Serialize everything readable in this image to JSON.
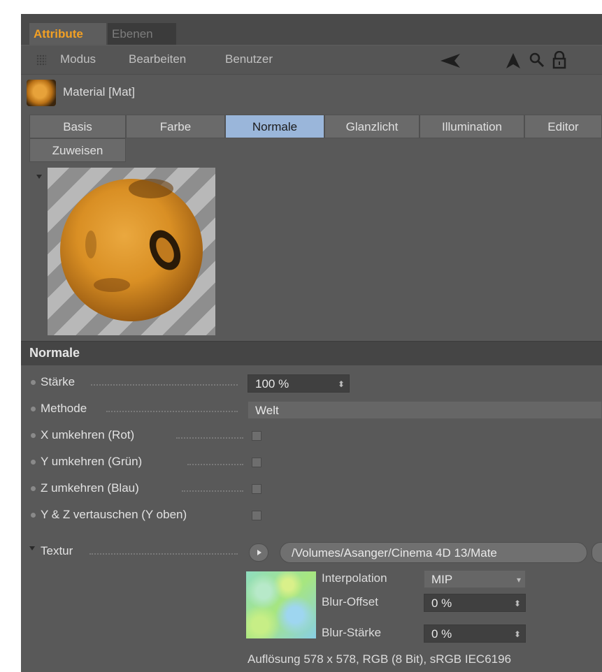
{
  "header": {
    "tabs": [
      {
        "label": "Attribute",
        "active": true
      },
      {
        "label": "Ebenen",
        "active": false
      }
    ],
    "menu": [
      "Modus",
      "Bearbeiten",
      "Benutzer"
    ],
    "icons": [
      "back-arrow-icon",
      "cursor-arrow-icon",
      "search-icon",
      "lock-icon"
    ]
  },
  "material": {
    "title": "Material [Mat]"
  },
  "material_tabs": [
    {
      "label": "Basis",
      "active": false
    },
    {
      "label": "Farbe",
      "active": false
    },
    {
      "label": "Normale",
      "active": true
    },
    {
      "label": "Glanzlicht",
      "active": false
    },
    {
      "label": "Illumination",
      "active": false
    },
    {
      "label": "Editor",
      "active": false
    },
    {
      "label": "Zuweisen",
      "active": false
    }
  ],
  "section": {
    "title": "Normale"
  },
  "params": {
    "staerke": {
      "label": "Stärke",
      "value": "100 %"
    },
    "methode": {
      "label": "Methode",
      "value": "Welt"
    },
    "x_umkehren": {
      "label": "X umkehren (Rot)",
      "checked": false
    },
    "y_umkehren": {
      "label": "Y umkehren (Grün)",
      "checked": false
    },
    "z_umkehren": {
      "label": "Z umkehren (Blau)",
      "checked": false
    },
    "yz_tauschen": {
      "label": "Y & Z vertauschen (Y oben)",
      "checked": false
    }
  },
  "textur": {
    "label": "Textur",
    "path": "/Volumes/Asanger/Cinema 4D 13/Mate",
    "interpolation_label": "Interpolation",
    "interpolation_value": "MIP",
    "blur_offset_label": "Blur-Offset",
    "blur_offset_value": "0 %",
    "blur_staerke_label": "Blur-Stärke",
    "blur_staerke_value": "0 %",
    "info": "Auflösung 578 x 578, RGB (8 Bit), sRGB IEC6196"
  },
  "colors": {
    "panel_bg": "#595959",
    "active_tab_text": "#f2a024",
    "active_material_tab": "#9ab6da"
  }
}
